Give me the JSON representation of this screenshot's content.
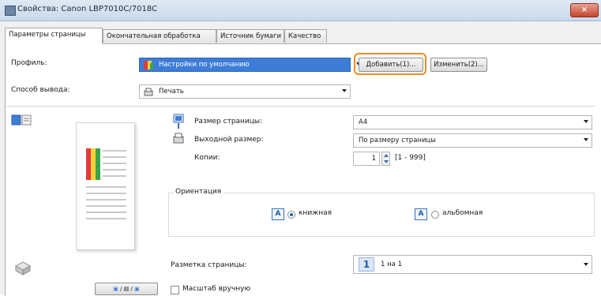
{
  "window": {
    "title": "Свойства: Canon LBP7010C/7018C",
    "close_label": "×"
  },
  "tabs": [
    {
      "label": "Параметры страницы"
    },
    {
      "label": "Окончательная обработка"
    },
    {
      "label": "Источник бумаги"
    },
    {
      "label": "Качество"
    }
  ],
  "profile": {
    "label": "Профиль:",
    "value": "Настройки по умолчанию",
    "add_button": "Добавить(1)...",
    "edit_button": "Изменить(2)..."
  },
  "output_method": {
    "label": "Способ вывода:",
    "value": "Печать"
  },
  "page_size": {
    "label": "Размер страницы:",
    "value": "A4"
  },
  "output_size": {
    "label": "Выходной размер:",
    "value": "По размеру страницы"
  },
  "copies": {
    "label": "Копии:",
    "value": "1",
    "range": "[1 - 999]"
  },
  "orientation": {
    "label": "Ориентация",
    "portrait_label": "книжная",
    "landscape_label": "альбомная",
    "icon_letter": "A",
    "selected": "portrait"
  },
  "page_layout": {
    "label": "Разметка страницы:",
    "value_number": "1",
    "value_text": "1 на 1"
  },
  "manual_scaling": {
    "label": "Масштаб вручную",
    "checked": false
  },
  "colors": {
    "highlight": "#f08a1e",
    "selection": "#3d7dd8"
  }
}
